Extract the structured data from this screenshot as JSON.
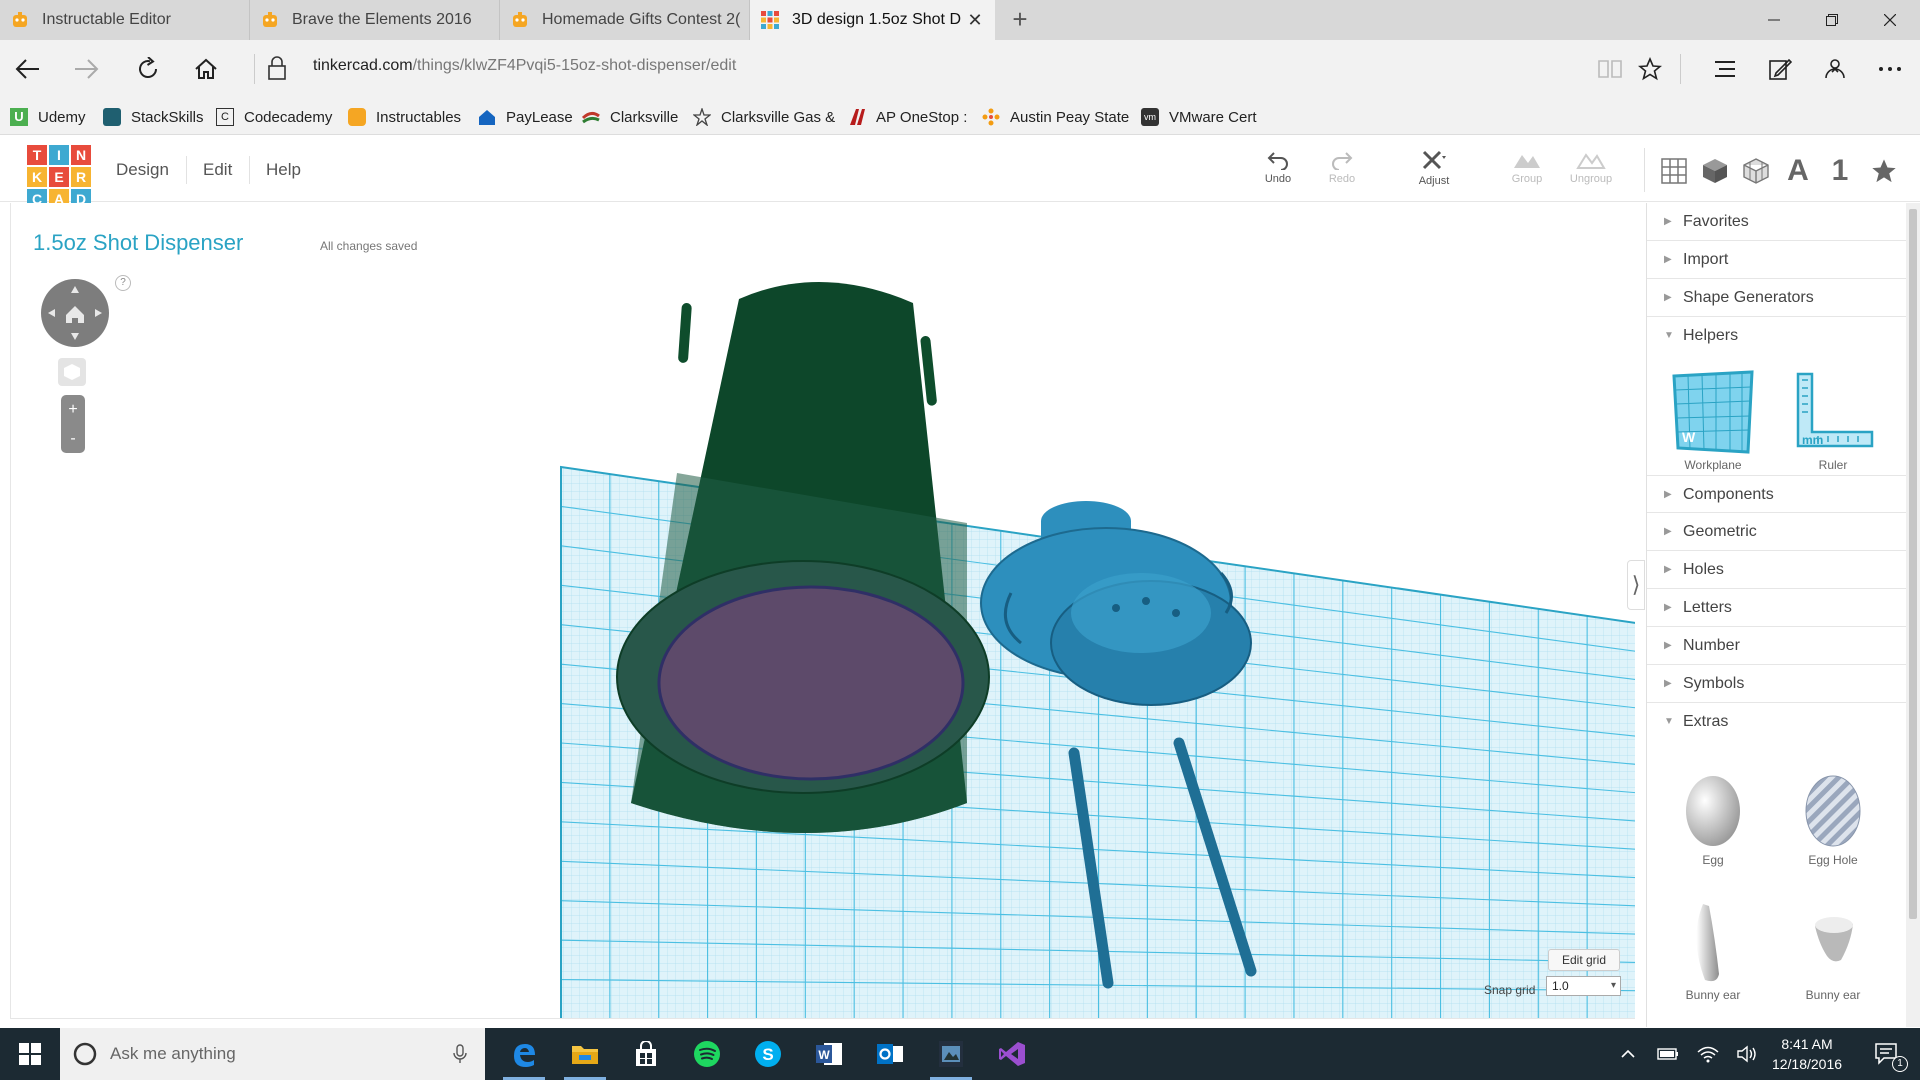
{
  "browser": {
    "tabs": [
      {
        "title": "Instructable Editor",
        "active": false
      },
      {
        "title": "Brave the Elements 2016",
        "active": false
      },
      {
        "title": "Homemade Gifts Contest 2(",
        "active": false
      },
      {
        "title": "3D design 1.5oz Shot D",
        "active": true
      }
    ],
    "url_domain": "tinkercad.com",
    "url_path": "/things/klwZF4Pvqi5-15oz-shot-dispenser/edit",
    "favorites": [
      {
        "label": "Udemy",
        "color": "#4caf50"
      },
      {
        "label": "StackSkills",
        "color": "#1f5f70"
      },
      {
        "label": "Codecademy",
        "color": "#333333"
      },
      {
        "label": "Instructables",
        "color": "#f5a623"
      },
      {
        "label": "PayLease",
        "color": "#1565c0"
      },
      {
        "label": "Clarksville",
        "color": "#c0392b"
      },
      {
        "label": "Clarksville Gas &",
        "color": "#555555"
      },
      {
        "label": "AP OneStop :",
        "color": "#b71c1c"
      },
      {
        "label": "Austin Peay State",
        "color": "#f39c12"
      },
      {
        "label": "VMware Cert",
        "color": "#333333"
      }
    ]
  },
  "app": {
    "logo_letters": [
      "T",
      "I",
      "N",
      "K",
      "E",
      "R",
      "C",
      "A",
      "D"
    ],
    "logo_colors": [
      "#e84b3c",
      "#3ea9d1",
      "#e84b3c",
      "#f7b431",
      "#e84b3c",
      "#f7b431",
      "#3ea9d1",
      "#f7b431",
      "#3ea9d1"
    ],
    "menu": [
      "Design",
      "Edit",
      "Help"
    ],
    "tools": {
      "undo": "Undo",
      "redo": "Redo",
      "adjust": "Adjust",
      "group": "Group",
      "ungroup": "Ungroup"
    },
    "view_letters": {
      "text": "A",
      "number": "1"
    }
  },
  "canvas": {
    "design_title": "1.5oz Shot Dispenser",
    "save_status": "All changes saved",
    "help_mark": "?",
    "zoom_in": "+",
    "zoom_out": "-",
    "edit_grid_label": "Edit grid",
    "snap_grid_label": "Snap grid",
    "snap_grid_value": "1.0",
    "colors": {
      "grid": "#5bc8e8",
      "cup": "#0e4d2c",
      "inner": "#6b4a72",
      "part": "#2d8fbd"
    }
  },
  "panel": {
    "categories": [
      {
        "label": "Favorites",
        "expanded": false
      },
      {
        "label": "Import",
        "expanded": false
      },
      {
        "label": "Shape Generators",
        "expanded": false
      },
      {
        "label": "Helpers",
        "expanded": true
      },
      {
        "label": "Components",
        "expanded": false
      },
      {
        "label": "Geometric",
        "expanded": false
      },
      {
        "label": "Holes",
        "expanded": false
      },
      {
        "label": "Letters",
        "expanded": false
      },
      {
        "label": "Number",
        "expanded": false
      },
      {
        "label": "Symbols",
        "expanded": false
      },
      {
        "label": "Extras",
        "expanded": true
      }
    ],
    "helpers": [
      {
        "label": "Workplane"
      },
      {
        "label": "Ruler"
      }
    ],
    "extras": [
      {
        "label": "Egg"
      },
      {
        "label": "Egg Hole"
      },
      {
        "label": "Bunny ear"
      },
      {
        "label": "Bunny ear"
      }
    ]
  },
  "taskbar": {
    "search_placeholder": "Ask me anything",
    "time": "8:41 AM",
    "date": "12/18/2016",
    "notification_count": "1"
  }
}
